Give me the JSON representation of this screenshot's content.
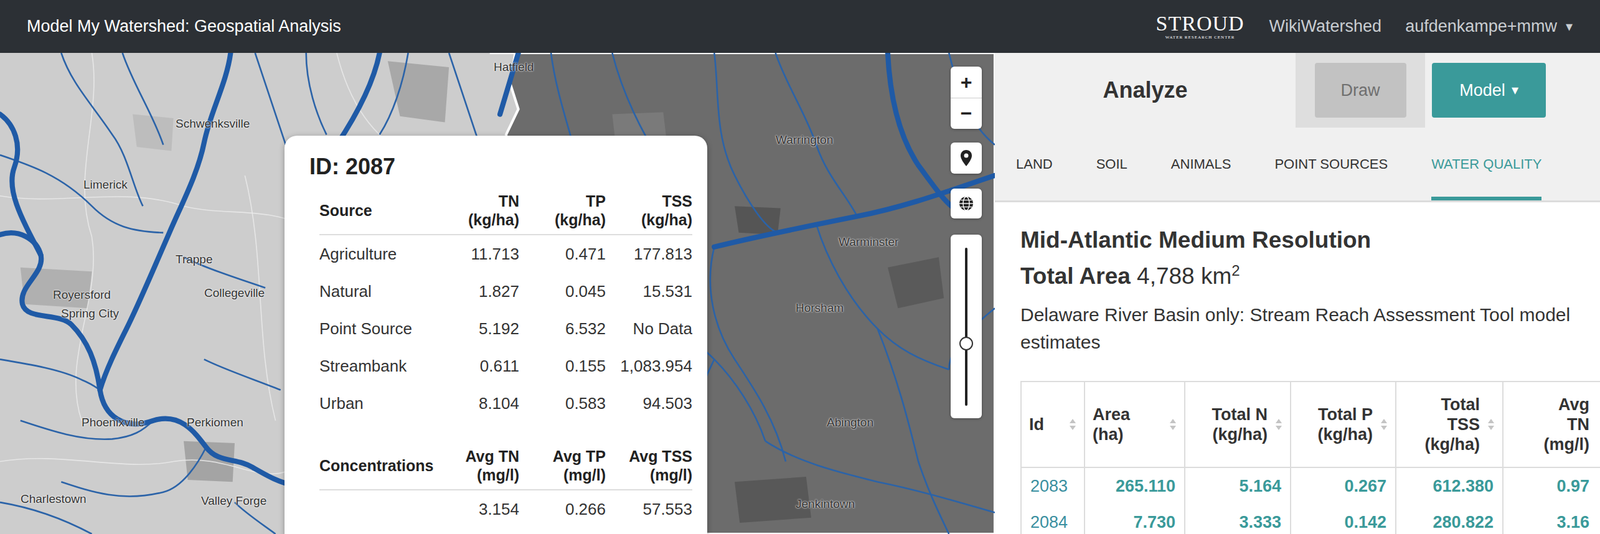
{
  "header": {
    "title": "Model My Watershed: Geospatial Analysis",
    "logo": {
      "name": "STROUD",
      "tagline": "WATER RESEARCH CENTER"
    },
    "links": [
      {
        "label": "WikiWatershed"
      }
    ],
    "user": {
      "label": "aufdenkampe+mmw",
      "caret": "▾"
    }
  },
  "map": {
    "labels": [
      {
        "text": "Hatfield"
      },
      {
        "text": "Schwenksville"
      },
      {
        "text": "Limerick"
      },
      {
        "text": "Trappe"
      },
      {
        "text": "Royersford"
      },
      {
        "text": "Spring City"
      },
      {
        "text": "Collegeville"
      },
      {
        "text": "Phoenixville"
      },
      {
        "text": "Perkiomen"
      },
      {
        "text": "Charlestown"
      },
      {
        "text": "Valley Forge"
      },
      {
        "text": "Warrington"
      },
      {
        "text": "Warminster"
      },
      {
        "text": "Horsham"
      },
      {
        "text": "Abington"
      },
      {
        "text": "Jenkintown"
      }
    ],
    "zoom_in": "+",
    "zoom_out": "−",
    "zoom_slider": {
      "level": 0.39
    }
  },
  "popup": {
    "title": "ID: 2087",
    "columns": [
      {
        "lines": [
          "Source"
        ]
      },
      {
        "lines": [
          "TN",
          "(kg/ha)"
        ]
      },
      {
        "lines": [
          "TP",
          "(kg/ha)"
        ]
      },
      {
        "lines": [
          "TSS",
          "(kg/ha)"
        ]
      }
    ],
    "rows": [
      {
        "source": "Agriculture",
        "values": [
          "11.713",
          "0.471",
          "177.813"
        ]
      },
      {
        "source": "Natural",
        "values": [
          "1.827",
          "0.045",
          "15.531"
        ]
      },
      {
        "source": "Point Source",
        "values": [
          "5.192",
          "6.532",
          "No Data"
        ]
      },
      {
        "source": "Streambank",
        "values": [
          "0.611",
          "0.155",
          "1,083.954"
        ]
      },
      {
        "source": "Urban",
        "values": [
          "8.104",
          "0.583",
          "94.503"
        ]
      }
    ],
    "concentrations": {
      "columns": [
        {
          "lines": [
            "Concentrations"
          ]
        },
        {
          "lines": [
            "Avg TN",
            "(mg/l)"
          ]
        },
        {
          "lines": [
            "Avg TP",
            "(mg/l)"
          ]
        },
        {
          "lines": [
            "Avg TSS",
            "(mg/l)"
          ]
        }
      ],
      "values": [
        "3.154",
        "0.266",
        "57.553"
      ]
    }
  },
  "panel": {
    "title": "Analyze",
    "buttons": [
      {
        "label": "Draw",
        "disabled": true,
        "caret": ""
      },
      {
        "label": "Model",
        "disabled": false,
        "caret": "▾"
      }
    ],
    "tabs": [
      {
        "label": "LAND",
        "selected": false
      },
      {
        "label": "SOIL",
        "selected": false
      },
      {
        "label": "ANIMALS",
        "selected": false
      },
      {
        "label": "POINT SOURCES",
        "selected": false
      },
      {
        "label": "WATER QUALITY",
        "selected": true
      }
    ],
    "heading": "Mid-Atlantic Medium Resolution",
    "total_area": {
      "label": "Total Area",
      "value": "4,788 km",
      "superscript": "2"
    },
    "note": "Delaware River Basin only: Stream Reach Assessment Tool model estimates",
    "table": {
      "columns": [
        {
          "lines": [
            "Id"
          ],
          "sortable": true
        },
        {
          "lines": [
            "Area",
            "(ha)"
          ],
          "sortable": true
        },
        {
          "lines": [
            "Total N",
            "(kg/ha)"
          ],
          "sortable": true
        },
        {
          "lines": [
            "Total P",
            "(kg/ha)"
          ],
          "sortable": true
        },
        {
          "lines": [
            "Total",
            "TSS",
            "(kg/ha)"
          ],
          "sortable": true
        },
        {
          "lines": [
            "Avg",
            "TN",
            "(mg/l)"
          ],
          "sortable": false
        }
      ],
      "rows": [
        {
          "id": "2083",
          "values": [
            "265.110",
            "5.164",
            "0.267",
            "612.380",
            "0.97"
          ]
        },
        {
          "id": "2084",
          "values": [
            "7.730",
            "3.333",
            "0.142",
            "280.822",
            "3.16"
          ]
        }
      ]
    }
  }
}
